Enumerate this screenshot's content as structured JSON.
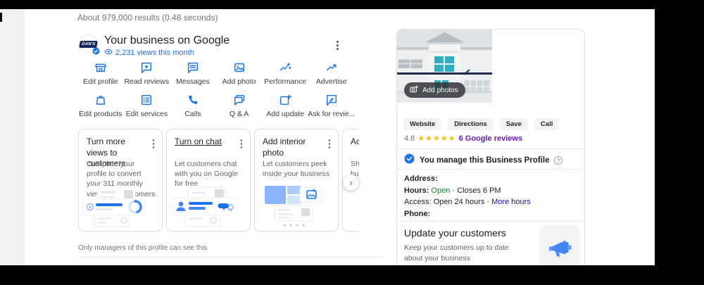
{
  "serp": {
    "stats_text": "About 979,000 results (0.48 seconds)"
  },
  "merchant_panel": {
    "logo_text": "DAN'S",
    "title": "Your business on Google",
    "views_text": "2,231 views this month",
    "actions_row1": [
      {
        "label": "Edit profile"
      },
      {
        "label": "Read reviews"
      },
      {
        "label": "Messages"
      },
      {
        "label": "Add photo"
      },
      {
        "label": "Performance"
      },
      {
        "label": "Advertise"
      }
    ],
    "actions_row2": [
      {
        "label": "Edit products"
      },
      {
        "label": "Edit services"
      },
      {
        "label": "Calls"
      },
      {
        "label": "Q & A"
      },
      {
        "label": "Add update"
      },
      {
        "label": "Ask for revie..."
      }
    ],
    "cards": [
      {
        "title": "Turn more views to customers",
        "body": "Complete your profile to convert your 311 monthly views into customers"
      },
      {
        "title": "Turn on chat",
        "body": "Let customers chat with you on Google for free"
      },
      {
        "title": "Add interior photo",
        "body": "Let customers peek inside your business"
      },
      {
        "title": "Ac",
        "body": "Sh\nbu"
      }
    ],
    "footer_note": "Only managers of this profile can see this"
  },
  "knowledge_panel": {
    "add_photos_label": "Add photos",
    "action_buttons": [
      "Website",
      "Directions",
      "Save",
      "Call"
    ],
    "rating": {
      "score": "4.8",
      "stars": "★★★★★",
      "reviews_link": "6 Google reviews"
    },
    "manage_text": "You manage this Business Profile",
    "details": {
      "address_label": "Address:",
      "hours_label": "Hours:",
      "hours_open": "Open",
      "hours_rest": "· Closes 6 PM",
      "access_text": "Access: Open 24 hours ·",
      "more_hours_link": "More hours",
      "phone_label": "Phone:"
    },
    "update_section": {
      "title": "Update your customers",
      "body": "Keep your customers up to date about your business"
    }
  },
  "colors": {
    "accent_blue": "#1a73e8",
    "star_orange": "#fbbc04",
    "open_green": "#188038",
    "visited_purple": "#681da8",
    "link_blue": "#1a0dab"
  }
}
